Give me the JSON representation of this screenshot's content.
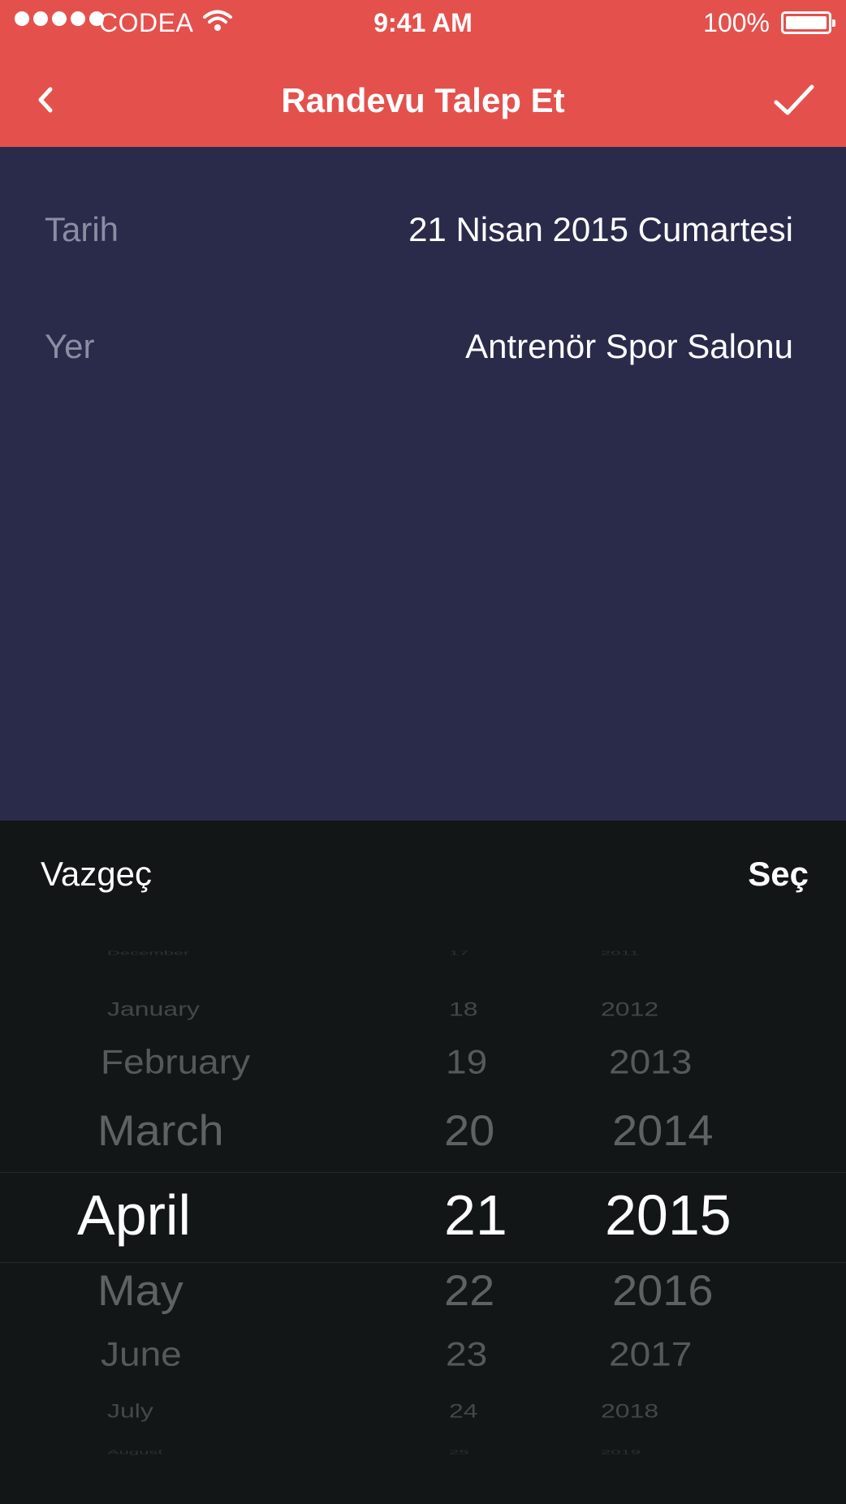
{
  "status_bar": {
    "carrier": "CODEA",
    "time": "9:41 AM",
    "battery": "100%"
  },
  "nav": {
    "title": "Randevu Talep Et"
  },
  "form": {
    "rows": [
      {
        "label": "Tarih",
        "value": "21 Nisan 2015 Cumartesi"
      },
      {
        "label": "Yer",
        "value": "Antrenör Spor Salonu"
      }
    ]
  },
  "picker": {
    "cancel_label": "Vazgeç",
    "select_label": "Seç",
    "months": [
      "December",
      "January",
      "February",
      "March",
      "April",
      "May",
      "June",
      "July",
      "August"
    ],
    "days": [
      "17",
      "18",
      "19",
      "20",
      "21",
      "22",
      "23",
      "24",
      "25"
    ],
    "years": [
      "2011",
      "2012",
      "2013",
      "2014",
      "2015",
      "2016",
      "2017",
      "2018",
      "2019"
    ],
    "selected": {
      "month": "April",
      "day": "21",
      "year": "2015"
    }
  },
  "colors": {
    "header": "#e4514d",
    "form_bg": "#2a2b4b",
    "picker_bg": "#121616"
  }
}
